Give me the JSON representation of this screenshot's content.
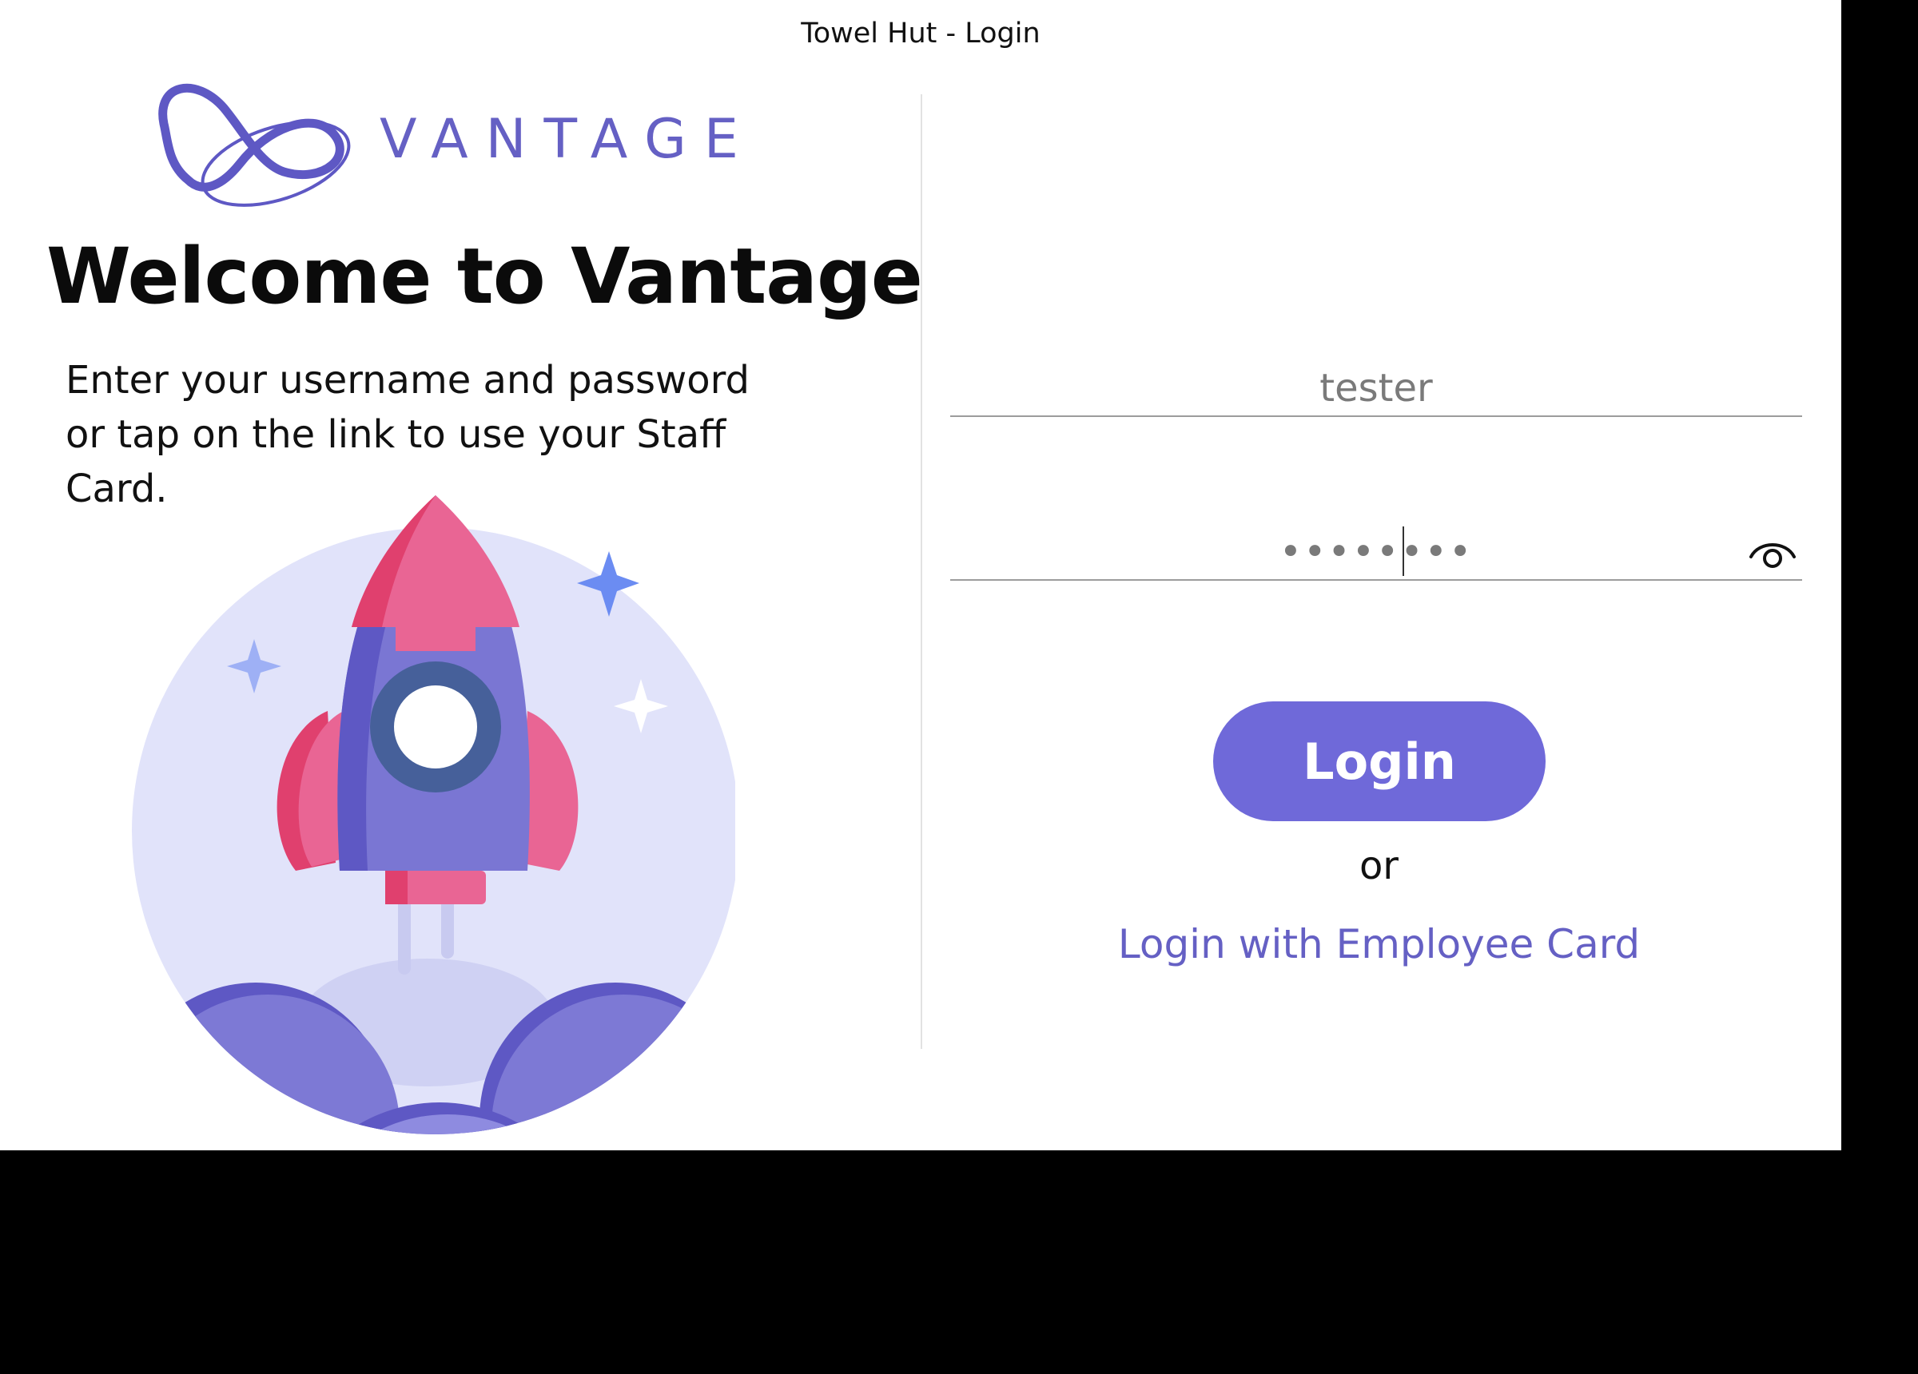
{
  "window": {
    "title": "Towel Hut - Login"
  },
  "brand": {
    "name": "VANTAGE",
    "color": "#6560c4"
  },
  "welcome": {
    "heading": "Welcome to Vantage",
    "instructions": "Enter your username and password or tap on the link to use your Staff Card."
  },
  "login_form": {
    "username_value": "tester",
    "password_masked": "••••••••",
    "show_password_icon": "eye-icon",
    "login_button": "Login",
    "separator": "or",
    "employee_card_link": "Login with Employee Card",
    "accent_color": "#6f69d9"
  },
  "illustration": {
    "icon": "rocket-launch-icon"
  }
}
